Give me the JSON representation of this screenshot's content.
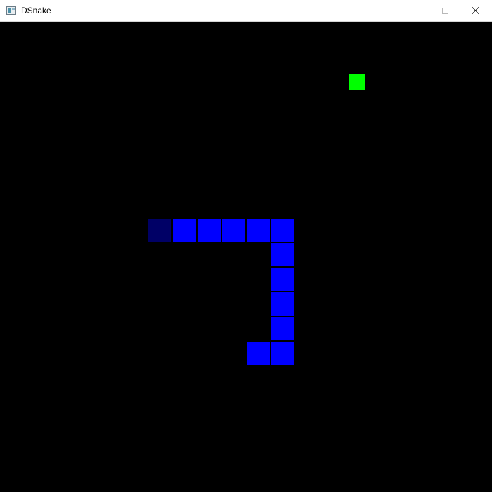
{
  "window": {
    "title": "DSnake"
  },
  "colors": {
    "snake_body": "#0000ff",
    "snake_tail": "#000066",
    "food": "#00ff00",
    "background": "#000000"
  },
  "icons": {
    "app": "app-window-icon",
    "minimize": "minimize-icon",
    "maximize": "maximize-icon",
    "close": "close-icon"
  },
  "game": {
    "snake_segments": [
      {
        "col": 0,
        "row": 0,
        "role": "tail"
      },
      {
        "col": 1,
        "row": 0,
        "role": "body"
      },
      {
        "col": 2,
        "row": 0,
        "role": "body"
      },
      {
        "col": 3,
        "row": 0,
        "role": "body"
      },
      {
        "col": 4,
        "row": 0,
        "role": "body"
      },
      {
        "col": 5,
        "row": 0,
        "role": "body"
      },
      {
        "col": 5,
        "row": 1,
        "role": "body"
      },
      {
        "col": 5,
        "row": 2,
        "role": "body"
      },
      {
        "col": 5,
        "row": 3,
        "role": "body"
      },
      {
        "col": 5,
        "row": 4,
        "role": "body"
      },
      {
        "col": 5,
        "row": 5,
        "role": "body"
      },
      {
        "col": 4,
        "row": 5,
        "role": "head"
      }
    ]
  }
}
